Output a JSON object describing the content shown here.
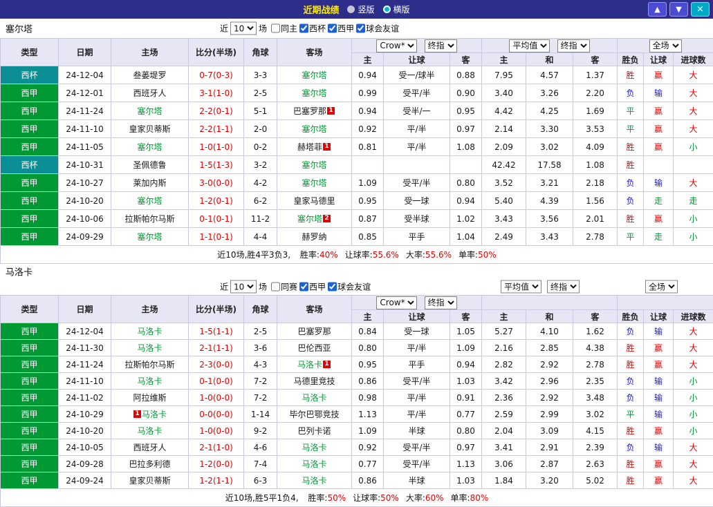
{
  "colors": {
    "bar_bg": "#2d2d8a",
    "title_yellow": "#ffeb00",
    "accent_teal": "#00a9c4",
    "red": "#e80000",
    "green": "#009933",
    "blue": "#1a1acc",
    "league_green": "#009933",
    "cup_teal": "#0b8e94",
    "focus_green": "#009933",
    "header_bg": "#e6e6f5"
  },
  "topbar": {
    "title": "近期战绩",
    "radios": [
      {
        "label": "竖版",
        "checked": false
      },
      {
        "label": "横版",
        "checked": true
      }
    ],
    "buttons": {
      "up": "▲",
      "down": "▼",
      "close": "×"
    }
  },
  "filter": {
    "near": "近",
    "count": "10",
    "games": "场"
  },
  "columns": {
    "left": [
      "类型",
      "日期",
      "主场",
      "比分(半场)",
      "角球",
      "客场"
    ],
    "odds_sub": [
      "主",
      "让球",
      "客",
      "主",
      "和",
      "客"
    ],
    "result_sub": [
      "胜负",
      "让球",
      "进球数"
    ],
    "selects": {
      "asian": [
        "Crow*",
        "终指"
      ],
      "euro": [
        "平均值",
        "终指"
      ],
      "scope": [
        "全场"
      ]
    }
  },
  "sections": [
    {
      "team": "塞尔塔",
      "checkboxes": [
        {
          "label": "同主",
          "checked": false
        },
        {
          "label": "西杯",
          "checked": true
        },
        {
          "label": "西甲",
          "checked": true
        },
        {
          "label": "球会友谊",
          "checked": true
        }
      ],
      "rows": [
        {
          "league": "西杯",
          "lc": "cup",
          "date": "24-12-04",
          "home": {
            "n": "叁蒌堤罗"
          },
          "score": "0-7(0-3)",
          "corner": "3-3",
          "away": {
            "n": "塞尔塔",
            "f": 1
          },
          "odds": [
            "0.94",
            "受一/球半",
            "0.88",
            "7.95",
            "4.57",
            "1.37"
          ],
          "res": [
            [
              "胜",
              "r"
            ],
            [
              "赢",
              "r"
            ],
            [
              "大",
              "r"
            ]
          ]
        },
        {
          "league": "西甲",
          "lc": "liga",
          "date": "24-12-01",
          "home": {
            "n": "西班牙人"
          },
          "score": "3-1(1-0)",
          "corner": "2-5",
          "away": {
            "n": "塞尔塔",
            "f": 1
          },
          "odds": [
            "0.99",
            "受平/半",
            "0.90",
            "3.40",
            "3.26",
            "2.20"
          ],
          "res": [
            [
              "负",
              "b"
            ],
            [
              "输",
              "b"
            ],
            [
              "大",
              "r"
            ]
          ]
        },
        {
          "league": "西甲",
          "lc": "liga",
          "date": "24-11-24",
          "home": {
            "n": "塞尔塔",
            "f": 1
          },
          "score": "2-2(0-1)",
          "corner": "5-1",
          "away": {
            "n": "巴塞罗那",
            "b": "1"
          },
          "odds": [
            "0.94",
            "受半/一",
            "0.95",
            "4.42",
            "4.25",
            "1.69"
          ],
          "res": [
            [
              "平",
              "g"
            ],
            [
              "赢",
              "r"
            ],
            [
              "大",
              "r"
            ]
          ]
        },
        {
          "league": "西甲",
          "lc": "liga",
          "date": "24-11-10",
          "home": {
            "n": "皇家贝蒂斯"
          },
          "score": "2-2(1-1)",
          "corner": "2-0",
          "away": {
            "n": "塞尔塔",
            "f": 1
          },
          "odds": [
            "0.92",
            "平/半",
            "0.97",
            "2.14",
            "3.30",
            "3.53"
          ],
          "res": [
            [
              "平",
              "g"
            ],
            [
              "赢",
              "r"
            ],
            [
              "大",
              "r"
            ]
          ]
        },
        {
          "league": "西甲",
          "lc": "liga",
          "date": "24-11-05",
          "home": {
            "n": "塞尔塔",
            "f": 1
          },
          "score": "1-0(1-0)",
          "corner": "0-2",
          "away": {
            "n": "赫塔菲",
            "b": "1"
          },
          "odds": [
            "0.81",
            "平/半",
            "1.08",
            "2.09",
            "3.02",
            "4.09"
          ],
          "res": [
            [
              "胜",
              "r"
            ],
            [
              "赢",
              "r"
            ],
            [
              "小",
              "g"
            ]
          ]
        },
        {
          "league": "西杯",
          "lc": "cup",
          "date": "24-10-31",
          "home": {
            "n": "圣佩德鲁"
          },
          "score": "1-5(1-3)",
          "corner": "3-2",
          "away": {
            "n": "塞尔塔",
            "f": 1
          },
          "odds": [
            "",
            "",
            "",
            "42.42",
            "17.58",
            "1.08"
          ],
          "res": [
            [
              "胜",
              "r"
            ],
            [
              "",
              ""
            ],
            [
              "",
              ""
            ]
          ]
        },
        {
          "league": "西甲",
          "lc": "liga",
          "date": "24-10-27",
          "home": {
            "n": "莱加内斯"
          },
          "score": "3-0(0-0)",
          "corner": "4-2",
          "away": {
            "n": "塞尔塔",
            "f": 1
          },
          "odds": [
            "1.09",
            "受平/半",
            "0.80",
            "3.52",
            "3.21",
            "2.18"
          ],
          "res": [
            [
              "负",
              "b"
            ],
            [
              "输",
              "b"
            ],
            [
              "大",
              "r"
            ]
          ]
        },
        {
          "league": "西甲",
          "lc": "liga",
          "date": "24-10-20",
          "home": {
            "n": "塞尔塔",
            "f": 1
          },
          "score": "1-2(0-1)",
          "corner": "6-2",
          "away": {
            "n": "皇家马德里"
          },
          "odds": [
            "0.95",
            "受一球",
            "0.94",
            "5.40",
            "4.39",
            "1.56"
          ],
          "res": [
            [
              "负",
              "b"
            ],
            [
              "走",
              "g"
            ],
            [
              "走",
              "g"
            ]
          ]
        },
        {
          "league": "西甲",
          "lc": "liga",
          "date": "24-10-06",
          "home": {
            "n": "拉斯帕尔马斯"
          },
          "score": "0-1(0-1)",
          "corner": "11-2",
          "away": {
            "n": "塞尔塔",
            "f": 1,
            "b": "2"
          },
          "odds": [
            "0.87",
            "受半球",
            "1.02",
            "3.43",
            "3.56",
            "2.01"
          ],
          "res": [
            [
              "胜",
              "r"
            ],
            [
              "赢",
              "r"
            ],
            [
              "小",
              "g"
            ]
          ]
        },
        {
          "league": "西甲",
          "lc": "liga",
          "date": "24-09-29",
          "home": {
            "n": "塞尔塔",
            "f": 1
          },
          "score": "1-1(0-1)",
          "corner": "4-4",
          "away": {
            "n": "赫罗纳"
          },
          "odds": [
            "0.85",
            "平手",
            "1.04",
            "2.49",
            "3.43",
            "2.78"
          ],
          "res": [
            [
              "平",
              "g"
            ],
            [
              "走",
              "g"
            ],
            [
              "小",
              "g"
            ]
          ]
        }
      ],
      "summary": {
        "prefix": "近10场,胜4平3负3,",
        "stats": [
          {
            "label": "胜率:",
            "value": "40%"
          },
          {
            "label": "让球率:",
            "value": "55.6%"
          },
          {
            "label": "大率:",
            "value": "55.6%"
          },
          {
            "label": "单率:",
            "value": "50%"
          }
        ]
      }
    },
    {
      "team": "马洛卡",
      "checkboxes": [
        {
          "label": "同赛",
          "checked": false
        },
        {
          "label": "西甲",
          "checked": true
        },
        {
          "label": "球会友谊",
          "checked": true
        }
      ],
      "rows": [
        {
          "league": "西甲",
          "lc": "liga",
          "date": "24-12-04",
          "home": {
            "n": "马洛卡",
            "f": 1
          },
          "score": "1-5(1-1)",
          "corner": "2-5",
          "away": {
            "n": "巴塞罗那"
          },
          "odds": [
            "0.84",
            "受一球",
            "1.05",
            "5.27",
            "4.10",
            "1.62"
          ],
          "res": [
            [
              "负",
              "b"
            ],
            [
              "输",
              "b"
            ],
            [
              "大",
              "r"
            ]
          ]
        },
        {
          "league": "西甲",
          "lc": "liga",
          "date": "24-11-30",
          "home": {
            "n": "马洛卡",
            "f": 1
          },
          "score": "2-1(1-1)",
          "corner": "3-6",
          "away": {
            "n": "巴伦西亚"
          },
          "odds": [
            "0.80",
            "平/半",
            "1.09",
            "2.16",
            "2.85",
            "4.38"
          ],
          "res": [
            [
              "胜",
              "r"
            ],
            [
              "赢",
              "r"
            ],
            [
              "大",
              "r"
            ]
          ]
        },
        {
          "league": "西甲",
          "lc": "liga",
          "date": "24-11-24",
          "home": {
            "n": "拉斯帕尔马斯"
          },
          "score": "2-3(0-0)",
          "corner": "4-3",
          "away": {
            "n": "马洛卡",
            "f": 1,
            "b": "1"
          },
          "odds": [
            "0.95",
            "平手",
            "0.94",
            "2.82",
            "2.92",
            "2.78"
          ],
          "res": [
            [
              "胜",
              "r"
            ],
            [
              "赢",
              "r"
            ],
            [
              "大",
              "r"
            ]
          ]
        },
        {
          "league": "西甲",
          "lc": "liga",
          "date": "24-11-10",
          "home": {
            "n": "马洛卡",
            "f": 1
          },
          "score": "0-1(0-0)",
          "corner": "7-2",
          "away": {
            "n": "马德里竞技"
          },
          "odds": [
            "0.86",
            "受平/半",
            "1.03",
            "3.42",
            "2.96",
            "2.35"
          ],
          "res": [
            [
              "负",
              "b"
            ],
            [
              "输",
              "b"
            ],
            [
              "小",
              "g"
            ]
          ]
        },
        {
          "league": "西甲",
          "lc": "liga",
          "date": "24-11-02",
          "home": {
            "n": "阿拉维斯"
          },
          "score": "1-0(0-0)",
          "corner": "7-2",
          "away": {
            "n": "马洛卡",
            "f": 1
          },
          "odds": [
            "0.98",
            "平/半",
            "0.91",
            "2.36",
            "2.92",
            "3.48"
          ],
          "res": [
            [
              "负",
              "b"
            ],
            [
              "输",
              "b"
            ],
            [
              "小",
              "g"
            ]
          ]
        },
        {
          "league": "西甲",
          "lc": "liga",
          "date": "24-10-29",
          "home": {
            "n": "马洛卡",
            "f": 1,
            "b": "1",
            "bl": 1
          },
          "score": "0-0(0-0)",
          "corner": "1-14",
          "away": {
            "n": "毕尔巴鄂竞技"
          },
          "odds": [
            "1.13",
            "平/半",
            "0.77",
            "2.59",
            "2.99",
            "3.02"
          ],
          "res": [
            [
              "平",
              "g"
            ],
            [
              "输",
              "b"
            ],
            [
              "小",
              "g"
            ]
          ]
        },
        {
          "league": "西甲",
          "lc": "liga",
          "date": "24-10-20",
          "home": {
            "n": "马洛卡",
            "f": 1
          },
          "score": "1-0(0-0)",
          "corner": "9-2",
          "away": {
            "n": "巴列卡诺"
          },
          "odds": [
            "1.09",
            "半球",
            "0.80",
            "2.04",
            "3.09",
            "4.15"
          ],
          "res": [
            [
              "胜",
              "r"
            ],
            [
              "赢",
              "r"
            ],
            [
              "小",
              "g"
            ]
          ]
        },
        {
          "league": "西甲",
          "lc": "liga",
          "date": "24-10-05",
          "home": {
            "n": "西班牙人"
          },
          "score": "2-1(1-0)",
          "corner": "4-6",
          "away": {
            "n": "马洛卡",
            "f": 1
          },
          "odds": [
            "0.92",
            "受平/半",
            "0.97",
            "3.41",
            "2.91",
            "2.39"
          ],
          "res": [
            [
              "负",
              "b"
            ],
            [
              "输",
              "b"
            ],
            [
              "大",
              "r"
            ]
          ]
        },
        {
          "league": "西甲",
          "lc": "liga",
          "date": "24-09-28",
          "home": {
            "n": "巴拉多利德"
          },
          "score": "1-2(0-0)",
          "corner": "7-4",
          "away": {
            "n": "马洛卡",
            "f": 1
          },
          "odds": [
            "0.77",
            "受平/半",
            "1.13",
            "3.06",
            "2.87",
            "2.63"
          ],
          "res": [
            [
              "胜",
              "r"
            ],
            [
              "赢",
              "r"
            ],
            [
              "大",
              "r"
            ]
          ]
        },
        {
          "league": "西甲",
          "lc": "liga",
          "date": "24-09-24",
          "home": {
            "n": "皇家贝蒂斯"
          },
          "score": "1-2(1-1)",
          "corner": "6-3",
          "away": {
            "n": "马洛卡",
            "f": 1
          },
          "odds": [
            "0.86",
            "半球",
            "1.03",
            "1.84",
            "3.20",
            "5.02"
          ],
          "res": [
            [
              "胜",
              "r"
            ],
            [
              "赢",
              "r"
            ],
            [
              "大",
              "r"
            ]
          ]
        }
      ],
      "summary": {
        "prefix": "近10场,胜5平1负4,",
        "stats": [
          {
            "label": "胜率:",
            "value": "50%"
          },
          {
            "label": "让球率:",
            "value": "50%"
          },
          {
            "label": "大率:",
            "value": "60%"
          },
          {
            "label": "单率:",
            "value": "80%"
          }
        ]
      }
    }
  ]
}
